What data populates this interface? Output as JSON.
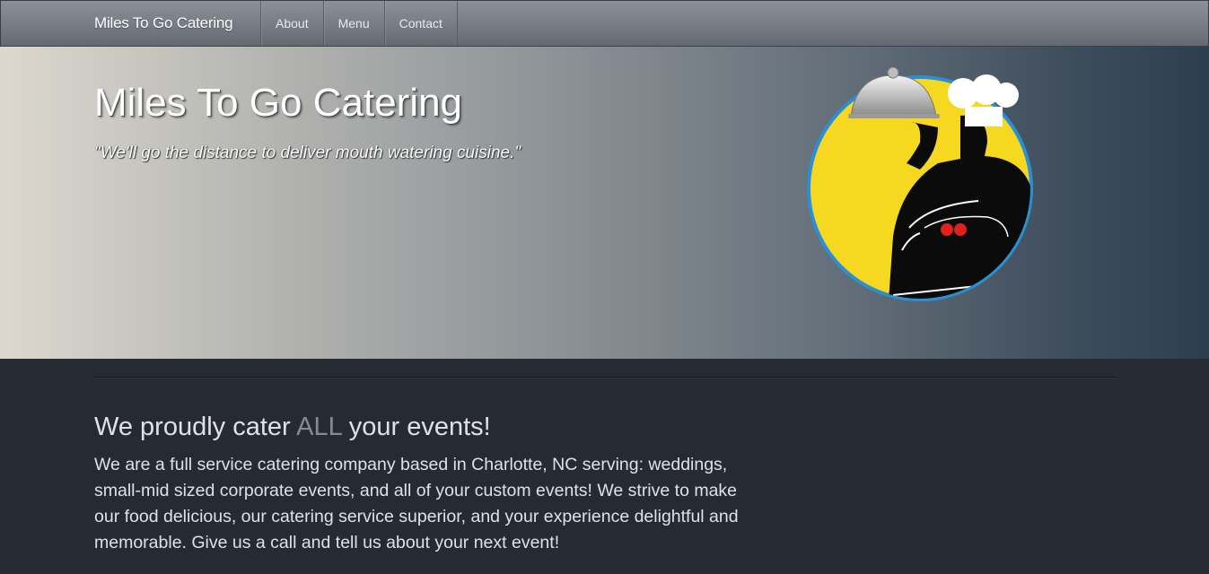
{
  "navbar": {
    "brand": "Miles To Go Catering",
    "items": [
      {
        "label": "About"
      },
      {
        "label": "Menu"
      },
      {
        "label": "Contact"
      }
    ]
  },
  "hero": {
    "title": "Miles To Go Catering",
    "tagline": "\"We'll go the distance to deliver mouth watering cuisine.\""
  },
  "content": {
    "heading_prefix": "We proudly cater ",
    "heading_highlight": "ALL",
    "heading_suffix": " your events!",
    "body": "We are a full service catering company based in Charlotte, NC serving: weddings, small-mid sized corporate events, and all of your custom events! We strive to make our food delicious, our catering service superior, and your experience delightful and memorable. Give us a call and tell us about your next event!"
  },
  "colors": {
    "navbar": "#7a8089",
    "hero_left": "#dcd8d0",
    "hero_right": "#2c3e50",
    "page_bg": "#262b33",
    "logo_yellow": "#f5d81f",
    "logo_ring": "#2b8fd6"
  },
  "icons": {
    "logo": "chef-car-logo-icon"
  }
}
